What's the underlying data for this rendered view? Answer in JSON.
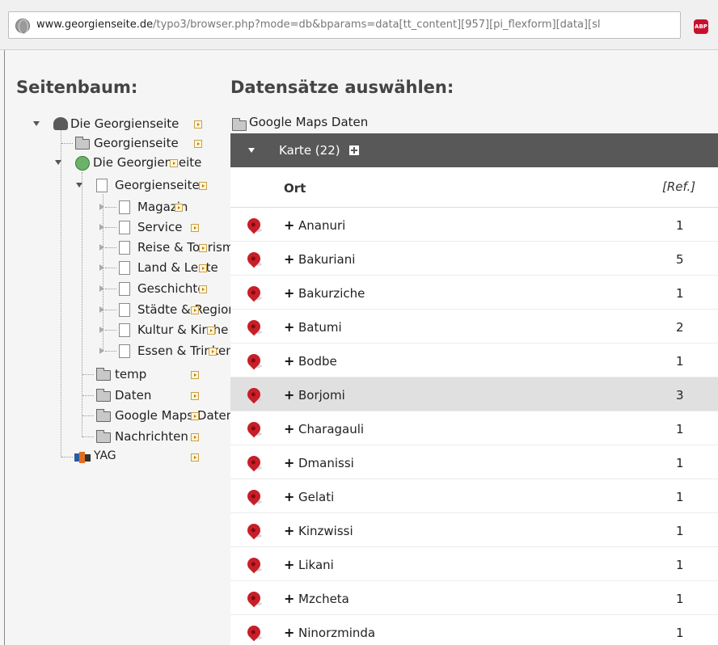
{
  "browser": {
    "url_domain": "www.georgienseite.de",
    "url_path": "/typo3/browser.php?mode=db&bparams=data[tt_content][957][pi_flexform][data][sl",
    "adblock_label": "ABP",
    "accent_color": "#c8102e"
  },
  "page_tree": {
    "title": "Seitenbaum:",
    "nodes": [
      {
        "label": "Die Georgienseite",
        "icon": "typo3-icon"
      },
      {
        "label": "Georgienseite",
        "icon": "folder-icon"
      },
      {
        "label": "Die Georgienseite",
        "icon": "site-icon"
      },
      {
        "label": "Georgienseite",
        "icon": "page-icon"
      },
      {
        "label": "Magazin",
        "icon": "page-icon"
      },
      {
        "label": "Service",
        "icon": "page-icon"
      },
      {
        "label": "Reise & Tourismus",
        "icon": "page-icon"
      },
      {
        "label": "Land & Leute",
        "icon": "page-icon"
      },
      {
        "label": "Geschichte",
        "icon": "page-icon"
      },
      {
        "label": "Städte & Regionen",
        "icon": "page-icon"
      },
      {
        "label": "Kultur & Kirche",
        "icon": "page-icon"
      },
      {
        "label": "Essen & Trinken",
        "icon": "page-icon"
      },
      {
        "label": "temp",
        "icon": "folder-icon"
      },
      {
        "label": "Daten",
        "icon": "folder-icon"
      },
      {
        "label": "Google Maps Daten",
        "icon": "folder-icon"
      },
      {
        "label": "Nachrichten",
        "icon": "folder-icon"
      },
      {
        "label": "YAG",
        "icon": "gallery-icon"
      }
    ]
  },
  "records": {
    "title": "Datensätze auswählen:",
    "folder_label": "Google Maps Daten",
    "table_label": "Karte (22)",
    "header_color": "#585858",
    "columns": {
      "ort": "Ort",
      "ref": "[Ref.]"
    },
    "rows": [
      {
        "name": "Ananuri",
        "ref": "1"
      },
      {
        "name": "Bakuriani",
        "ref": "5"
      },
      {
        "name": "Bakurziche",
        "ref": "1"
      },
      {
        "name": "Batumi",
        "ref": "2"
      },
      {
        "name": "Bodbe",
        "ref": "1"
      },
      {
        "name": "Borjomi",
        "ref": "3"
      },
      {
        "name": "Charagauli",
        "ref": "1"
      },
      {
        "name": "Dmanissi",
        "ref": "1"
      },
      {
        "name": "Gelati",
        "ref": "1"
      },
      {
        "name": "Kinzwissi",
        "ref": "1"
      },
      {
        "name": "Likani",
        "ref": "1"
      },
      {
        "name": "Mzcheta",
        "ref": "1"
      },
      {
        "name": "Ninorzminda",
        "ref": "1"
      }
    ],
    "plus_sign": "+"
  }
}
